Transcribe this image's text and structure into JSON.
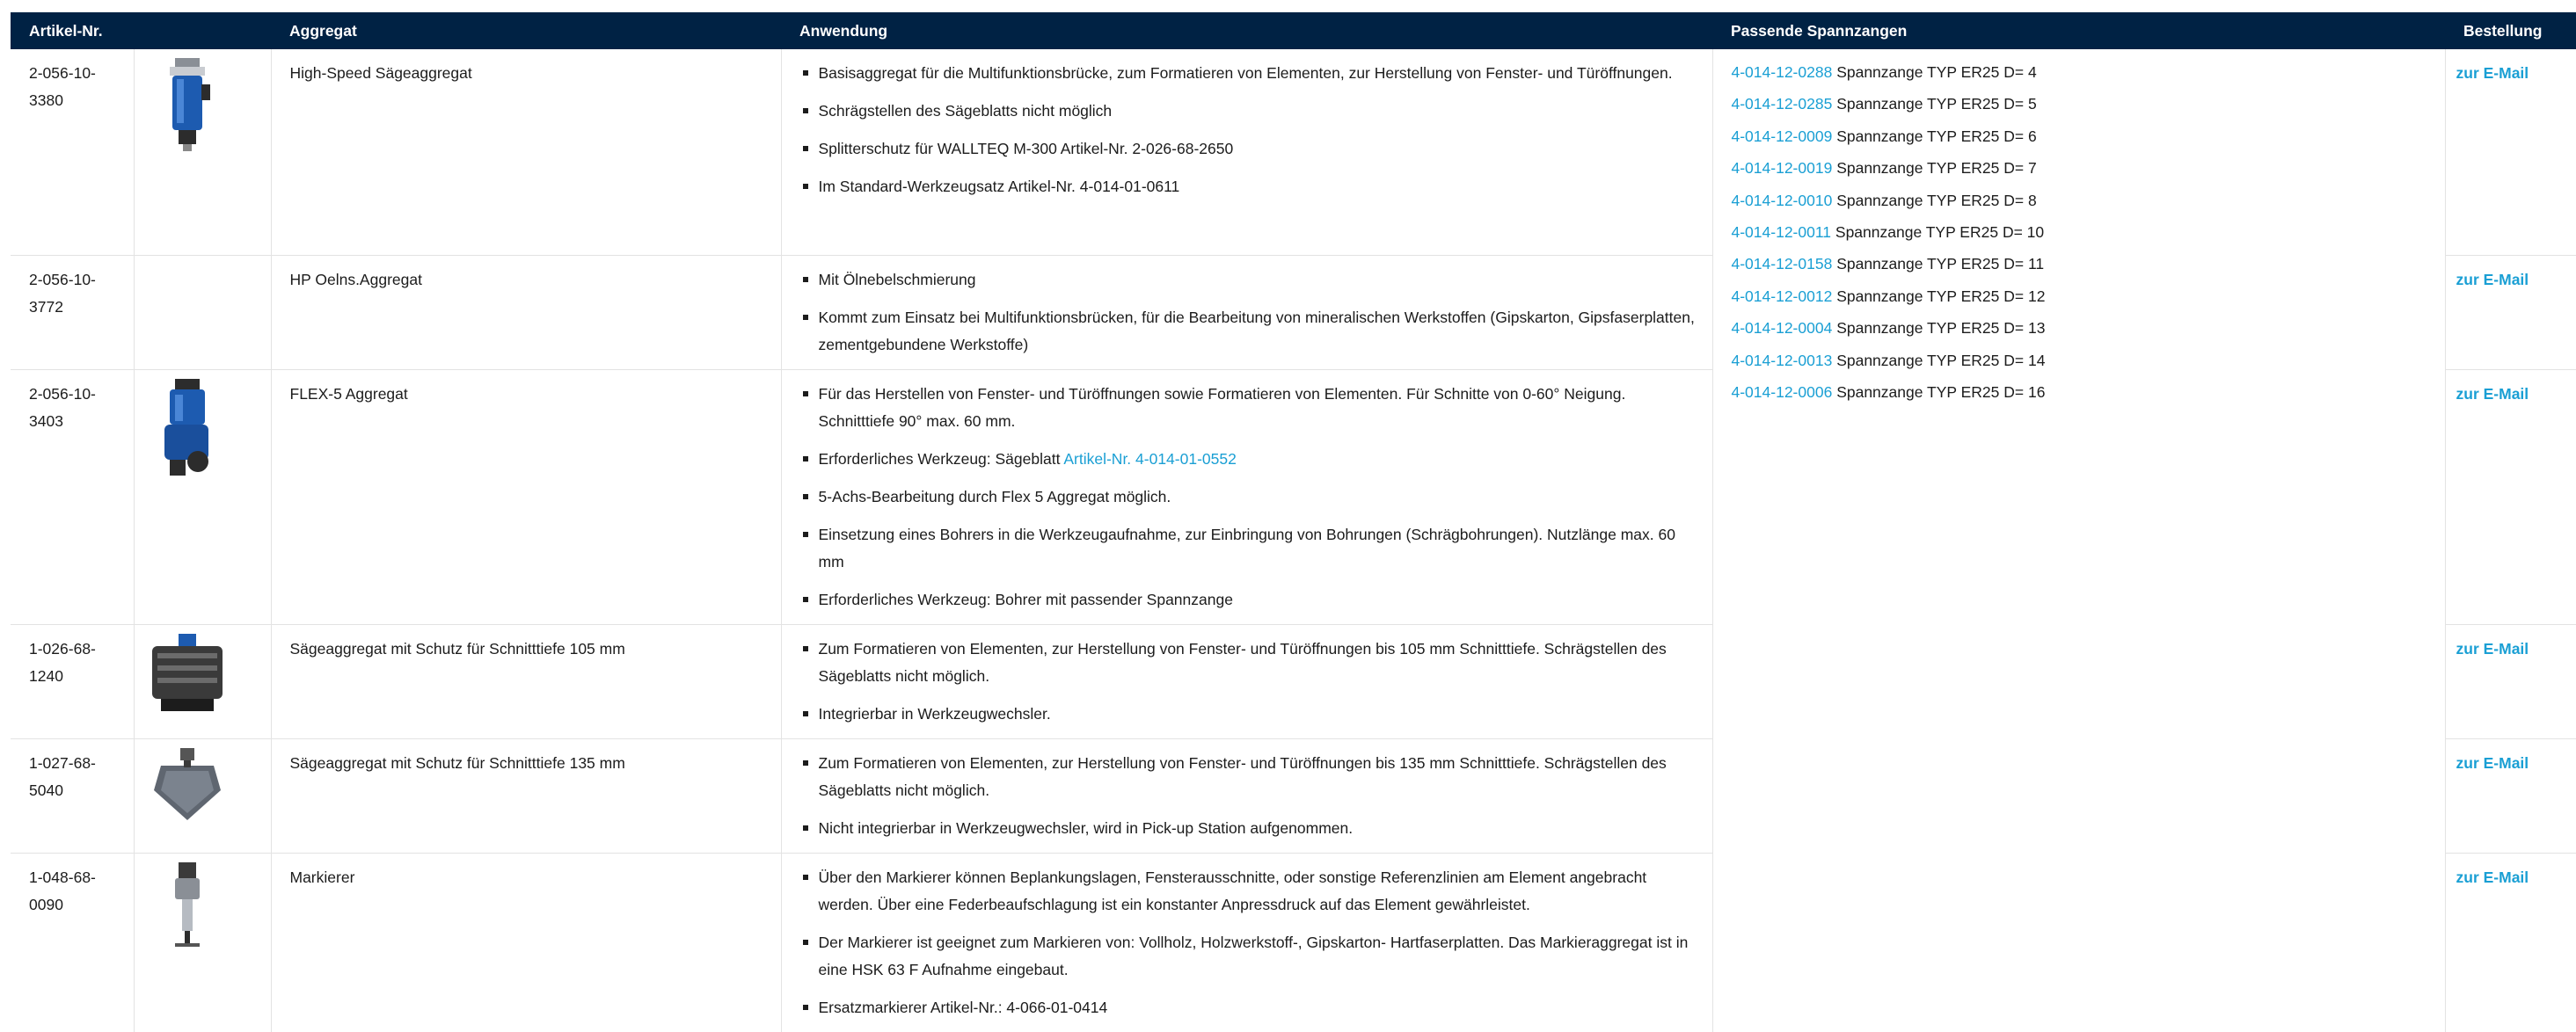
{
  "header": {
    "artikel": "Artikel-Nr.",
    "aggregat": "Aggregat",
    "anwendung": "Anwendung",
    "spannzangen": "Passende Spannzangen",
    "bestellung": "Bestellung"
  },
  "order_label": "zur E-Mail",
  "rows": [
    {
      "artikel": "2-056-10-3380",
      "name": "High-Speed Sägeaggregat",
      "bullets": [
        "Basisaggregat für die Multifunktionsbrücke, zum Formatieren von Elementen, zur Herstellung von Fenster- und Türöffnungen.",
        "Schrägstellen des Sägeblatts nicht möglich",
        "Splitterschutz für WALLTEQ M-300 Artikel-Nr. 2-026-68-2650",
        "Im Standard-Werkzeugsatz Artikel-Nr. 4-014-01-0611"
      ]
    },
    {
      "artikel": "2-056-10-3772",
      "name": "HP Oelns.Aggregat",
      "bullets": [
        "Mit Ölnebelschmierung",
        "Kommt zum Einsatz bei Multifunktionsbrücken, für die Bearbeitung von mineralischen Werkstoffen (Gipskarton, Gipsfaserplatten, zementgebundene Werkstoffe)"
      ]
    },
    {
      "artikel": "2-056-10-3403",
      "name": "FLEX-5 Aggregat",
      "bullets": [
        "Für das Herstellen von Fenster- und Türöffnungen sowie Formatieren von Elementen. Für Schnitte von 0-60° Neigung. Schnitttiefe 90° max. 60 mm.",
        "Erforderliches Werkzeug: Sägeblatt ",
        "5-Achs-Bearbeitung durch Flex 5 Aggregat möglich.",
        "Einsetzung eines Bohrers in die Werkzeugaufnahme, zur Einbringung von Bohrungen (Schrägbohrungen). Nutzlänge max. 60 mm",
        "Erforderliches Werkzeug: Bohrer mit passender Spannzange"
      ],
      "link": "Artikel-Nr. 4-014-01-0552"
    },
    {
      "artikel": "1-026-68-1240",
      "name": "Sägeaggregat mit Schutz für Schnitttiefe 105 mm",
      "bullets": [
        "Zum Formatieren von Elementen, zur Herstellung von Fenster- und Türöffnungen bis 105 mm Schnitttiefe.  Schrägstellen des Sägeblatts nicht möglich.",
        "Integrierbar in Werkzeugwechsler."
      ]
    },
    {
      "artikel": "1-027-68-5040",
      "name": "Sägeaggregat mit Schutz für Schnitttiefe 135 mm",
      "bullets": [
        "Zum Formatieren von Elementen, zur Herstellung von Fenster- und Türöffnungen bis 135 mm Schnitttiefe.  Schrägstellen des Sägeblatts nicht möglich.",
        "Nicht integrierbar in Werkzeugwechsler, wird in Pick-up Station aufgenommen."
      ]
    },
    {
      "artikel": "1-048-68-0090",
      "name": "Markierer",
      "bullets": [
        "Über den Markierer können Beplankungslagen, Fensterausschnitte, oder sonstige Referenzlinien am Element angebracht werden. Über eine Federbeaufschlagung ist ein konstanter Anpressdruck auf das Element gewährleistet.",
        "Der Markierer ist geeignet zum Markieren von: Vollholz, Holzwerkstoff-, Gipskarton- Hartfaserplatten. Das Markieraggregat ist in eine HSK 63 F Aufnahme eingebaut.",
        "Ersatzmarkierer Artikel-Nr.: 4-066-01-0414"
      ]
    }
  ],
  "spannzangen": [
    {
      "code": "4-014-12-0288",
      "text": "Spannzange TYP ER25 D= 4"
    },
    {
      "code": "4-014-12-0285",
      "text": "Spannzange TYP ER25 D= 5"
    },
    {
      "code": "4-014-12-0009",
      "text": "Spannzange TYP ER25 D= 6"
    },
    {
      "code": "4-014-12-0019",
      "text": "Spannzange TYP ER25 D= 7"
    },
    {
      "code": "4-014-12-0010",
      "text": "Spannzange TYP ER25 D= 8"
    },
    {
      "code": "4-014-12-0011",
      "text": "Spannzange TYP ER25 D= 10"
    },
    {
      "code": "4-014-12-0158",
      "text": "Spannzange TYP ER25 D= 11"
    },
    {
      "code": "4-014-12-0012",
      "text": "Spannzange TYP ER25 D= 12"
    },
    {
      "code": "4-014-12-0004",
      "text": "Spannzange TYP ER25 D= 13"
    },
    {
      "code": "4-014-12-0013",
      "text": "Spannzange TYP ER25 D= 14"
    },
    {
      "code": "4-014-12-0006",
      "text": "Spannzange TYP ER25 D= 16"
    }
  ],
  "colors": {
    "header_bg": "#002244",
    "link": "#1a9fd4",
    "text": "#1c1c1c"
  },
  "icons": [
    "saw-aggregate-icon",
    "flex5-aggregate-icon",
    "saw-guard-105-icon",
    "saw-guard-135-icon",
    "marker-icon"
  ]
}
